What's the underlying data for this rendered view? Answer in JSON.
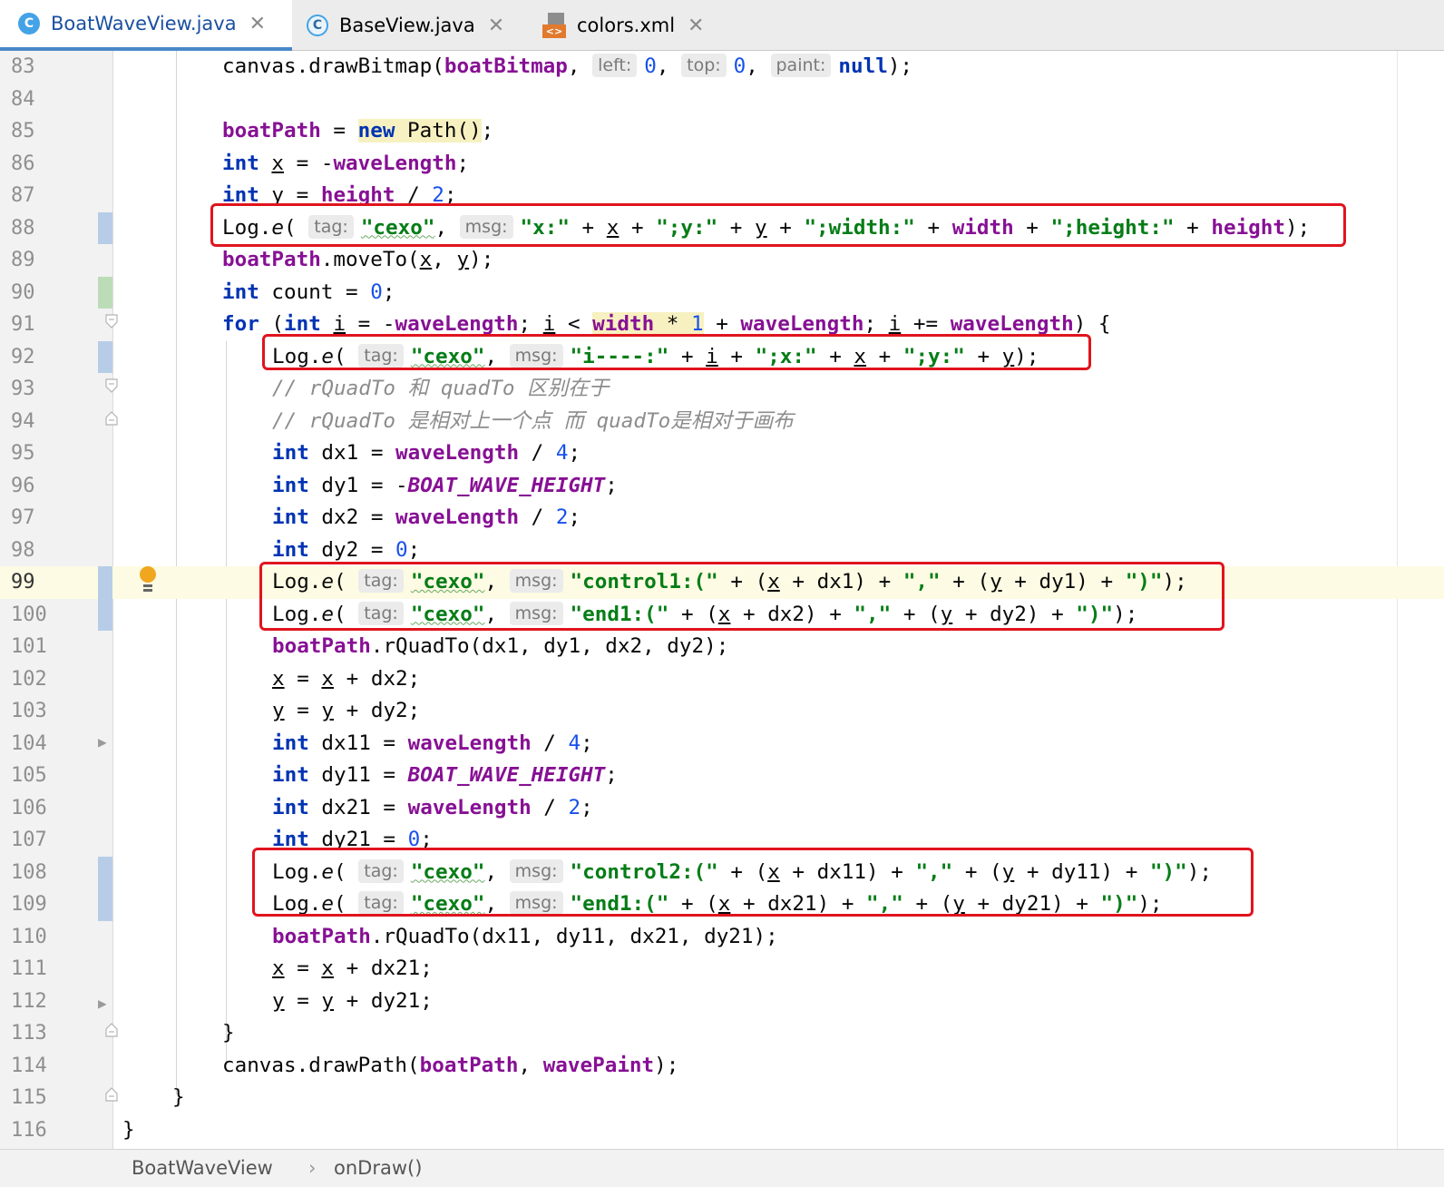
{
  "tabs": [
    {
      "label": "BoatWaveView.java",
      "icon": "java-class-icon",
      "icon_glyph": "C",
      "active": true
    },
    {
      "label": "BaseView.java",
      "icon": "java-class-icon",
      "icon_glyph": "C",
      "active": false
    },
    {
      "label": "colors.xml",
      "icon": "xml-file-icon",
      "icon_glyph": "<>",
      "active": false
    }
  ],
  "close_glyph": "✕",
  "hints": {
    "left": "left:",
    "top": "top:",
    "paint": "paint:",
    "tag": "tag:",
    "msg": "msg:"
  },
  "lines": [
    {
      "n": "83"
    },
    {
      "n": "84"
    },
    {
      "n": "85"
    },
    {
      "n": "86"
    },
    {
      "n": "87"
    },
    {
      "n": "88"
    },
    {
      "n": "89"
    },
    {
      "n": "90"
    },
    {
      "n": "91"
    },
    {
      "n": "92"
    },
    {
      "n": "93"
    },
    {
      "n": "94"
    },
    {
      "n": "95"
    },
    {
      "n": "96"
    },
    {
      "n": "97"
    },
    {
      "n": "98"
    },
    {
      "n": "99"
    },
    {
      "n": "100"
    },
    {
      "n": "101"
    },
    {
      "n": "102"
    },
    {
      "n": "103"
    },
    {
      "n": "104"
    },
    {
      "n": "105"
    },
    {
      "n": "106"
    },
    {
      "n": "107"
    },
    {
      "n": "108"
    },
    {
      "n": "109"
    },
    {
      "n": "110"
    },
    {
      "n": "111"
    },
    {
      "n": "112"
    },
    {
      "n": "113"
    },
    {
      "n": "114"
    },
    {
      "n": "115"
    },
    {
      "n": "116"
    }
  ],
  "code": {
    "l83": {
      "a": "canvas.drawBitmap(",
      "f": "boatBitmap",
      "b": ", ",
      "v1": "0",
      "c1": ", ",
      "v2": "0",
      "c2": ", ",
      "kw": "null",
      "e": ");"
    },
    "l85": {
      "f": "boatPath",
      "a": " = ",
      "kw": "new",
      "b": " Path()",
      "e": ";"
    },
    "l86": {
      "kw": "int",
      "a": " ",
      "var": "x",
      "b": " = -",
      "f": "waveLength",
      "e": ";"
    },
    "l87": {
      "kw": "int",
      "a": " ",
      "var": "y",
      "b": " = ",
      "f": "height",
      "c": " / ",
      "num": "2",
      "e": ";"
    },
    "l88": {
      "a": "Log.",
      "m": "e",
      "b": "( ",
      "s1": "\"cexo\"",
      "c": ", ",
      "s2": "\"x:\"",
      "p1": " + ",
      "v1": "x",
      "p2": " + ",
      "s3": "\";y:\"",
      "p3": " + ",
      "v2": "y",
      "p4": " + ",
      "s4": "\";width:\"",
      "p5": " + ",
      "f1": "width",
      "p6": " + ",
      "s5": "\";height:\"",
      "p7": " + ",
      "f2": "height",
      "e": ");"
    },
    "l89": {
      "f": "boatPath",
      "a": ".moveTo(",
      "v1": "x",
      "c": ", ",
      "v2": "y",
      "e": ");"
    },
    "l90": {
      "kw": "int",
      "a": " count = ",
      "num": "0",
      "e": ";"
    },
    "l91": {
      "kw1": "for",
      "a": " (",
      "kw2": "int",
      "b": " ",
      "v1": "i",
      "c": " = -",
      "f1": "waveLength",
      "d": "; ",
      "v2": "i",
      "g": " < ",
      "f2": "width",
      "h": " * ",
      "num": "1",
      "j": " + ",
      "f3": "waveLength",
      "k": "; ",
      "v3": "i",
      "m": " += ",
      "f4": "waveLength",
      "e": ") {"
    },
    "l92": {
      "a": "Log.",
      "m": "e",
      "b": "( ",
      "s1": "\"cexo\"",
      "c": ", ",
      "s2": "\"i----:\"",
      "p1": " + ",
      "v1": "i",
      "p2": " + ",
      "s3": "\";x:\"",
      "p3": " + ",
      "v2": "x",
      "p4": " + ",
      "s4": "\";y:\"",
      "p5": " + ",
      "v3": "y",
      "e": ");"
    },
    "l93": {
      "cmt": "// rQuadTo 和 quadTo 区别在于"
    },
    "l94": {
      "cmt": "// rQuadTo 是相对上一个点 而 quadTo是相对于画布"
    },
    "l95": {
      "kw": "int",
      "a": " dx1 = ",
      "f": "waveLength",
      "b": " / ",
      "num": "4",
      "e": ";"
    },
    "l96": {
      "kw": "int",
      "a": " dy1 = -",
      "f": "BOAT_WAVE_HEIGHT",
      "e": ";"
    },
    "l97": {
      "kw": "int",
      "a": " dx2 = ",
      "f": "waveLength",
      "b": " / ",
      "num": "2",
      "e": ";"
    },
    "l98": {
      "kw": "int",
      "a": " dy2 = ",
      "num": "0",
      "e": ";"
    },
    "l99": {
      "a": "Log.",
      "m": "e",
      "b": "( ",
      "s1": "\"cexo\"",
      "c": ", ",
      "s2": "\"control1:(\"",
      "p1": " + (",
      "v1": "x",
      "p2": " + dx1) + ",
      "s3": "\",\"",
      "p3": " + (",
      "v2": "y",
      "p4": " + dy1) + ",
      "s4": "\")\"",
      "e": ");"
    },
    "l100": {
      "a": "Log.",
      "m": "e",
      "b": "( ",
      "s1": "\"cexo\"",
      "c": ", ",
      "s2": "\"end1:(\"",
      "p1": " + (",
      "v1": "x",
      "p2": " + dx2) + ",
      "s3": "\",\"",
      "p3": " + (",
      "v2": "y",
      "p4": " + dy2) + ",
      "s4": "\")\"",
      "e": ");"
    },
    "l101": {
      "f": "boatPath",
      "a": ".rQuadTo(dx1, dy1, dx2, dy2);"
    },
    "l102": {
      "v1": "x",
      "a": " = ",
      "v2": "x",
      "e": " + dx2;"
    },
    "l103": {
      "v1": "y",
      "a": " = ",
      "v2": "y",
      "e": " + dy2;"
    },
    "l104": {
      "kw": "int",
      "a": " dx11 = ",
      "f": "waveLength",
      "b": " / ",
      "num": "4",
      "e": ";"
    },
    "l105": {
      "kw": "int",
      "a": " dy11 = ",
      "f": "BOAT_WAVE_HEIGHT",
      "e": ";"
    },
    "l106": {
      "kw": "int",
      "a": " dx21 = ",
      "f": "waveLength",
      "b": " / ",
      "num": "2",
      "e": ";"
    },
    "l107": {
      "kw": "int",
      "a": " dy21 = ",
      "num": "0",
      "e": ";"
    },
    "l108": {
      "a": "Log.",
      "m": "e",
      "b": "( ",
      "s1": "\"cexo\"",
      "c": ", ",
      "s2": "\"control2:(\"",
      "p1": " + (",
      "v1": "x",
      "p2": " + dx11) + ",
      "s3": "\",\"",
      "p3": " + (",
      "v2": "y",
      "p4": " + dy11) + ",
      "s4": "\")\"",
      "e": ");"
    },
    "l109": {
      "a": "Log.",
      "m": "e",
      "b": "( ",
      "s1": "\"cexo\"",
      "c": ", ",
      "s2": "\"end1:(\"",
      "p1": " + (",
      "v1": "x",
      "p2": " + dx21) + ",
      "s3": "\",\"",
      "p3": " + (",
      "v2": "y",
      "p4": " + dy21) + ",
      "s4": "\")\"",
      "e": ");"
    },
    "l110": {
      "f": "boatPath",
      "a": ".rQuadTo(dx11, dy11, dx21, dy21);"
    },
    "l111": {
      "v1": "x",
      "a": " = ",
      "v2": "x",
      "e": " + dx21;"
    },
    "l112": {
      "v1": "y",
      "a": " = ",
      "v2": "y",
      "e": " + dy21;"
    },
    "l113": {
      "a": "}"
    },
    "l114": {
      "a": "canvas.drawPath(",
      "f1": "boatPath",
      "b": ", ",
      "f2": "wavePaint",
      "e": ");"
    },
    "l115": {
      "a": "}"
    },
    "l116": {
      "a": "}"
    }
  },
  "breadcrumb": {
    "class_name": "BoatWaveView",
    "separator": "›",
    "method": "onDraw()"
  },
  "colors": {
    "keyword": "#0033b3",
    "field": "#871094",
    "string": "#067d17",
    "number": "#1750eb",
    "comment": "#8c8c8c",
    "highlight_box": "#e0141e",
    "active_tab": "#4a88c7"
  }
}
